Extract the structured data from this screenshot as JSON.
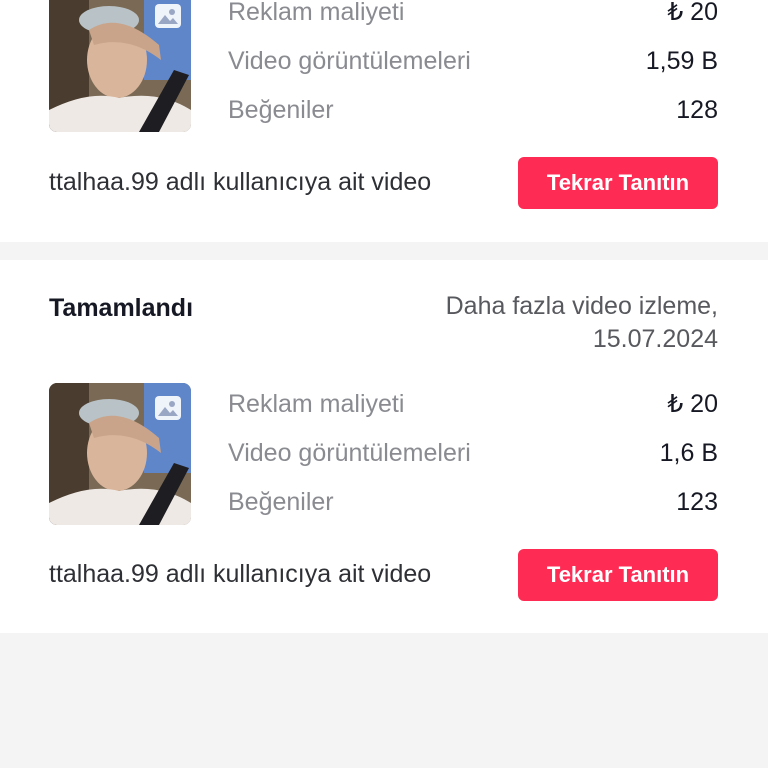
{
  "campaigns": [
    {
      "ad_cost_label": "Reklam maliyeti",
      "ad_cost_value": "₺ 20",
      "views_label": "Video görüntülemeleri",
      "views_value": "1,59 B",
      "likes_label": "Beğeniler",
      "likes_value": "128",
      "owner_text": "ttalhaa.99 adlı kullanıcıya ait video",
      "promote_again_label": "Tekrar Tanıtın"
    },
    {
      "status": "Tamamlandı",
      "goal_line1": "Daha fazla video izleme,",
      "goal_line2": "15.07.2024",
      "ad_cost_label": "Reklam maliyeti",
      "ad_cost_value": "₺ 20",
      "views_label": "Video görüntülemeleri",
      "views_value": "1,6 B",
      "likes_label": "Beğeniler",
      "likes_value": "123",
      "owner_text": "ttalhaa.99 adlı kullanıcıya ait video",
      "promote_again_label": "Tekrar Tanıtın"
    }
  ],
  "colors": {
    "accent": "#fe2c55",
    "background": "#f4f4f5",
    "card": "#ffffff"
  },
  "icons": {
    "thumbnail_badge": "photo-icon"
  }
}
